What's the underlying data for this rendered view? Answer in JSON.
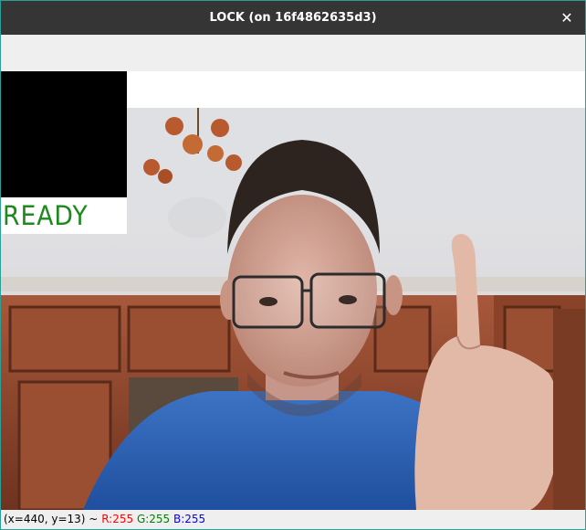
{
  "window": {
    "title": "LOCK (on 16f4862635d3)",
    "close_glyph": "✕",
    "accent_border": "#2aa198"
  },
  "overlay": {
    "status_text": "READY",
    "status_color": "#1c8a1c"
  },
  "camera": {
    "subject": "webcam-frame-person-raising-index-finger"
  },
  "statusbar": {
    "coords": "(x=440, y=13) ~",
    "r_label": "R:255",
    "g_label": "G:255",
    "b_label": "B:255",
    "r_color": "#ff0000",
    "g_color": "#008000",
    "b_color": "#0000ff"
  }
}
